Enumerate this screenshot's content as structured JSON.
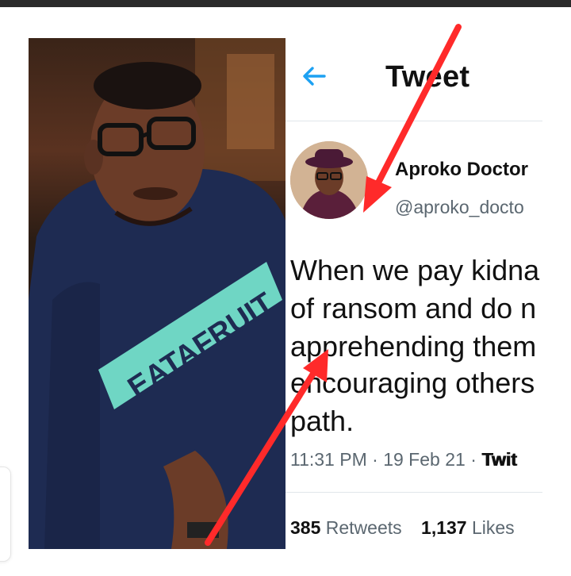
{
  "header": {
    "title": "Tweet",
    "back_icon": "arrow-left-icon",
    "back_color": "#1da1f2"
  },
  "author": {
    "name": "Aproko Doctor",
    "handle": "@aproko_docto"
  },
  "tweet": {
    "lines": [
      "When we pay kidna",
      "of ransom and do n",
      "apprehending them",
      "encouraging others",
      "path."
    ],
    "time": "11:31 PM",
    "date": "19 Feb 21",
    "source": "Twit",
    "separator": "·"
  },
  "stats": {
    "retweets_count": "385",
    "retweets_label": "Retweets",
    "likes_count": "1,137",
    "likes_label": "Likes"
  },
  "photo": {
    "shirt_text": "EATAFRUIT"
  },
  "annotation": {
    "arrow_color": "#ff2a2a"
  }
}
